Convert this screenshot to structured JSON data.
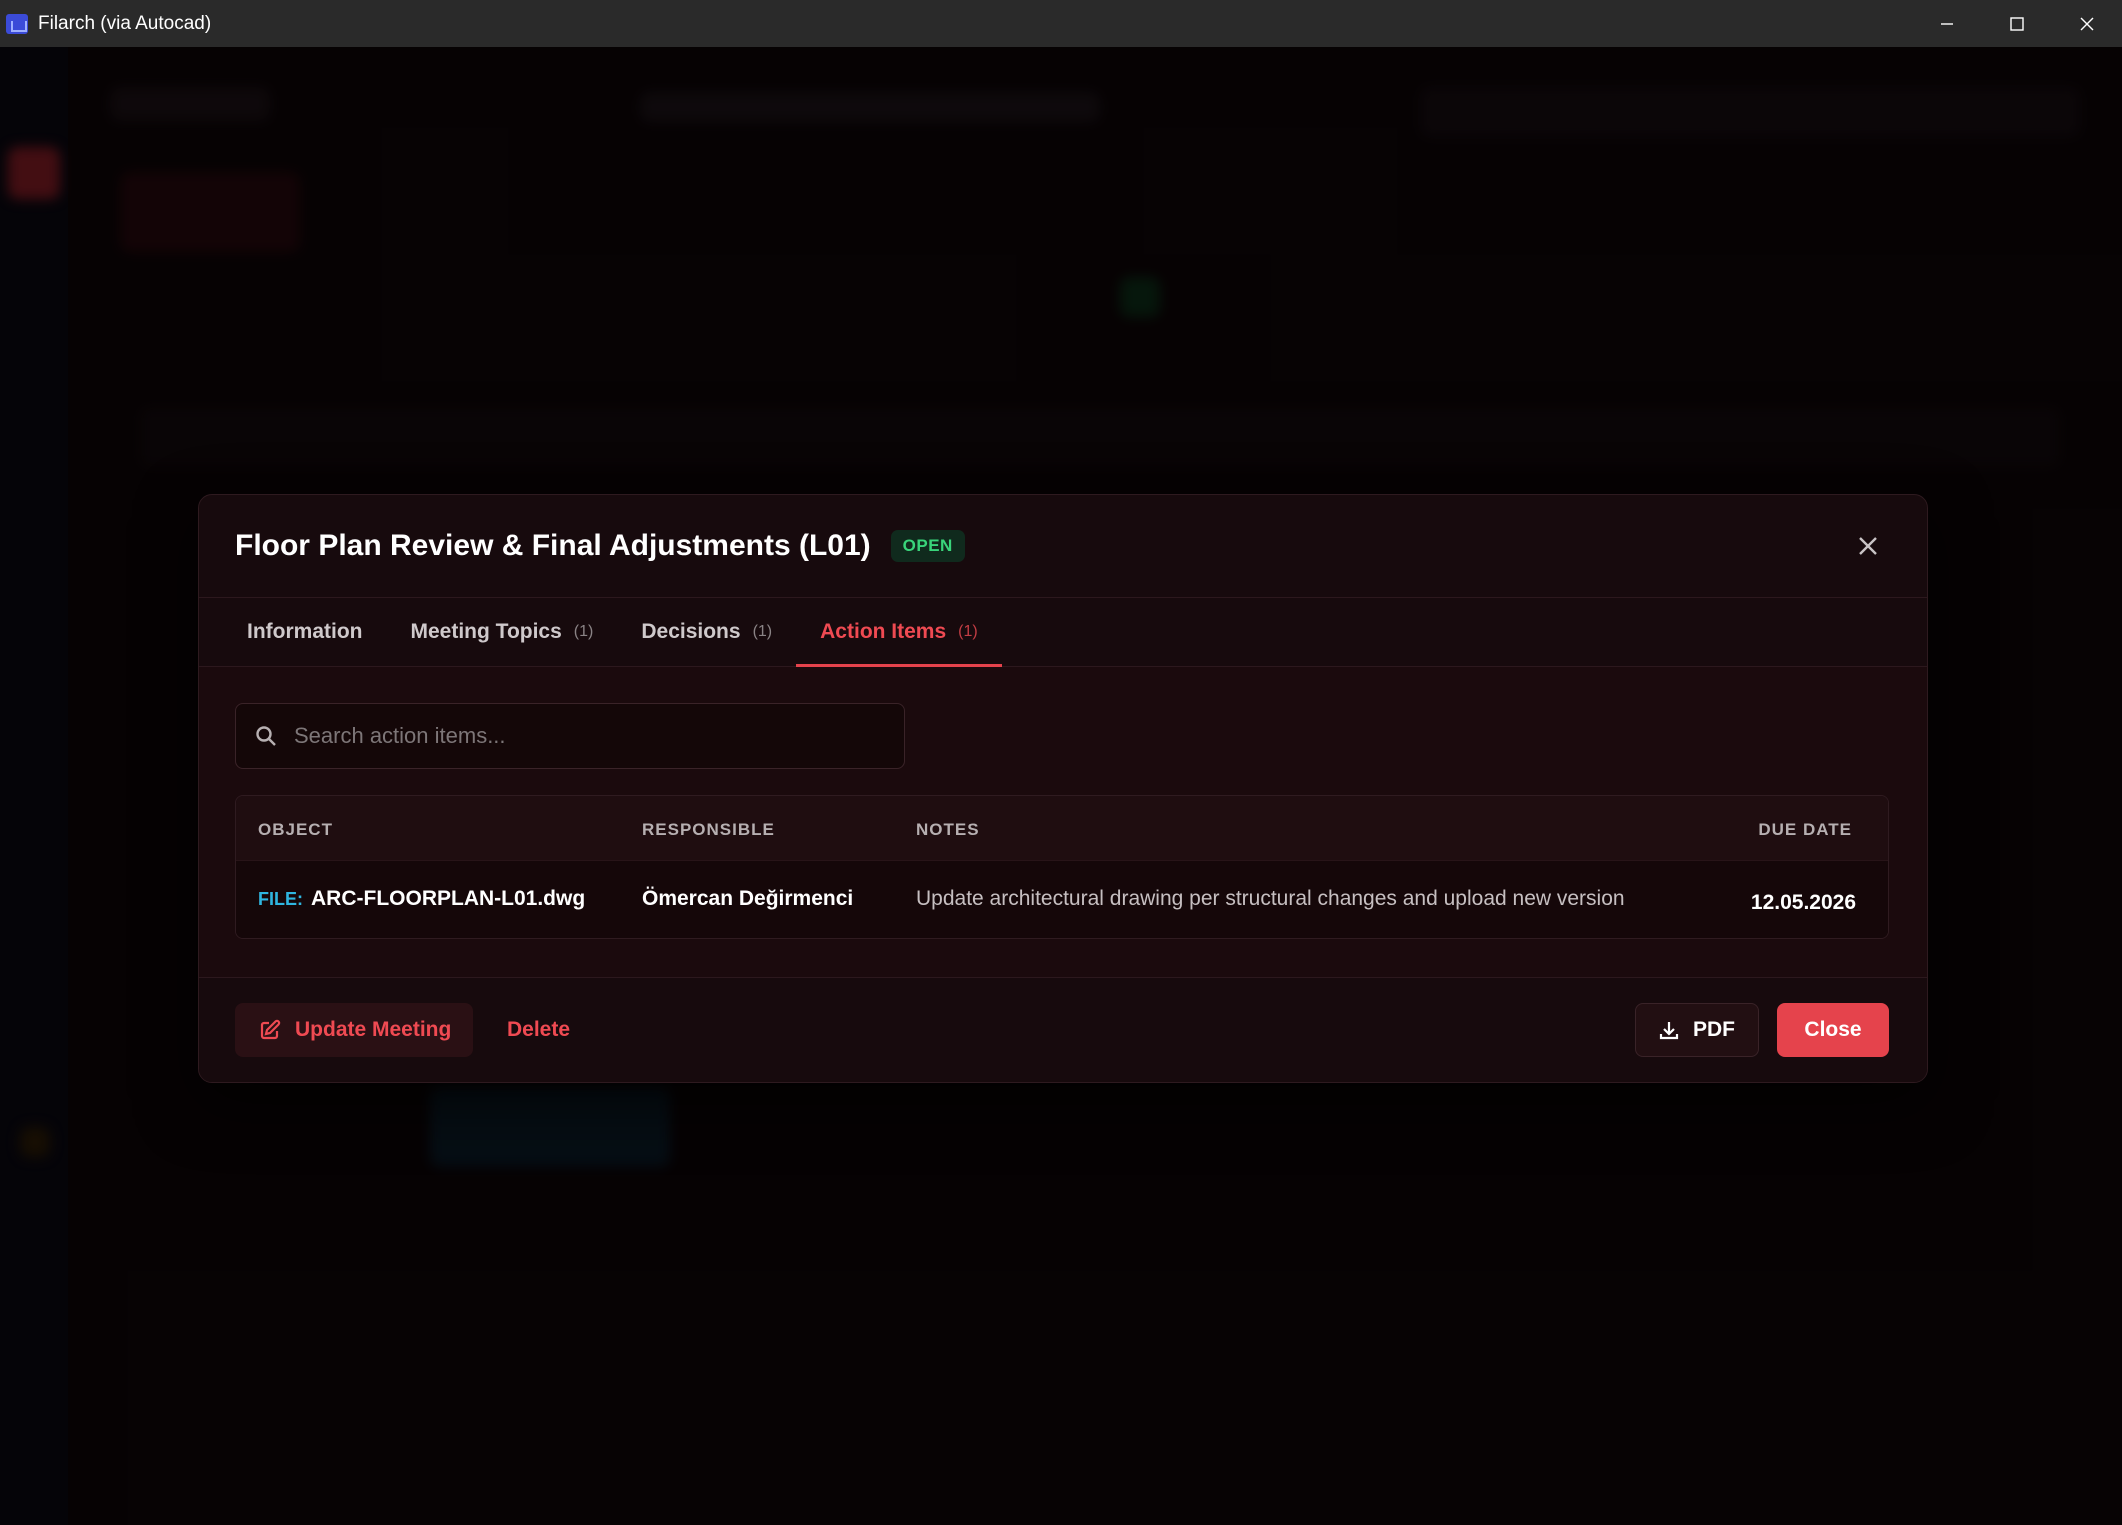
{
  "window": {
    "title": "Filarch (via Autocad)"
  },
  "modal": {
    "title": "Floor Plan Review & Final Adjustments (L01)",
    "status": "OPEN",
    "tabs": [
      {
        "label": "Information",
        "count": ""
      },
      {
        "label": "Meeting Topics",
        "count": "(1)"
      },
      {
        "label": "Decisions",
        "count": "(1)"
      },
      {
        "label": "Action Items",
        "count": "(1)"
      }
    ],
    "active_tab": "Action Items",
    "search": {
      "placeholder": "Search action items..."
    },
    "table": {
      "columns": [
        "OBJECT",
        "RESPONSIBLE",
        "NOTES",
        "DUE DATE"
      ],
      "rows": [
        {
          "object_prefix": "FILE:",
          "object_name": "ARC-FLOORPLAN-L01.dwg",
          "responsible": "Ömercan Değirmenci",
          "notes": "Update architectural drawing per structural changes and upload new version",
          "due_date": "12.05.2026"
        }
      ]
    },
    "footer": {
      "update_label": "Update Meeting",
      "delete_label": "Delete",
      "pdf_label": "PDF",
      "close_label": "Close"
    }
  },
  "colors": {
    "accent": "#e5434c",
    "status_open": "#39d47a",
    "file_prefix": "#2fb6e0"
  }
}
